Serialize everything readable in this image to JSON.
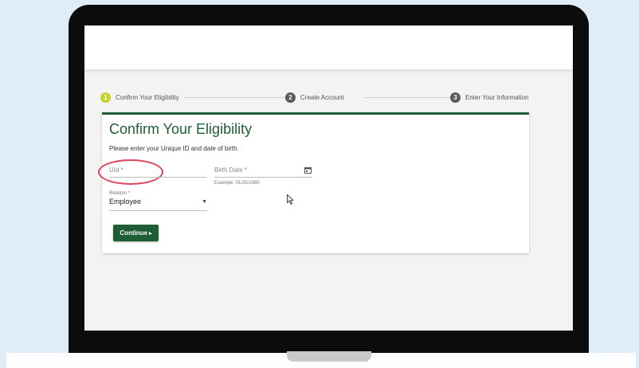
{
  "stepper": {
    "steps": [
      {
        "number": "1",
        "label": "Confirm Your Eligibility",
        "color": "#c8d22f"
      },
      {
        "number": "2",
        "label": "Create Account",
        "color": "#5b5b5b"
      },
      {
        "number": "3",
        "label": "Enter Your Information",
        "color": "#5b5b5b"
      }
    ]
  },
  "form": {
    "title": "Confirm Your Eligibility",
    "subtitle": "Please enter your Unique ID and date of birth.",
    "uid": {
      "placeholder": "UId *"
    },
    "birth_date": {
      "placeholder": "Birth Date *",
      "hint": "Example: 01/25/1980",
      "icon": "calendar-icon"
    },
    "relation": {
      "label": "Relation *",
      "value": "Employee",
      "icon": "caret-down-icon"
    },
    "continue_label": "Continue"
  },
  "colors": {
    "brand_green": "#1f5e35",
    "active_step": "#c8d22f",
    "highlight": "#d9465d"
  }
}
